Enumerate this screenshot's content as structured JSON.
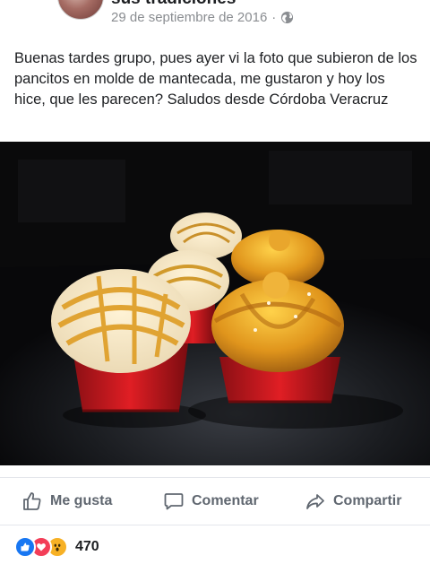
{
  "post": {
    "group_name": "sus tradiciones",
    "timestamp": "29 de septiembre de 2016",
    "separator": "·",
    "privacy_icon": "globe-icon",
    "text": "Buenas tardes grupo,  pues ayer vi la foto que subieron de los pancitos en molde de mantecada,  me gustaron y hoy los hice,  que les parecen?  Saludos desde Córdoba Veracruz"
  },
  "actions": {
    "like_label": "Me gusta",
    "comment_label": "Comentar",
    "share_label": "Compartir"
  },
  "reactions": {
    "icons": [
      "like-icon",
      "love-icon",
      "wow-icon"
    ],
    "count": "470"
  },
  "colors": {
    "link_blue": "#1877f2",
    "love_red": "#f33e58",
    "wow_yellow": "#f7b125",
    "action_gray": "#606770"
  }
}
